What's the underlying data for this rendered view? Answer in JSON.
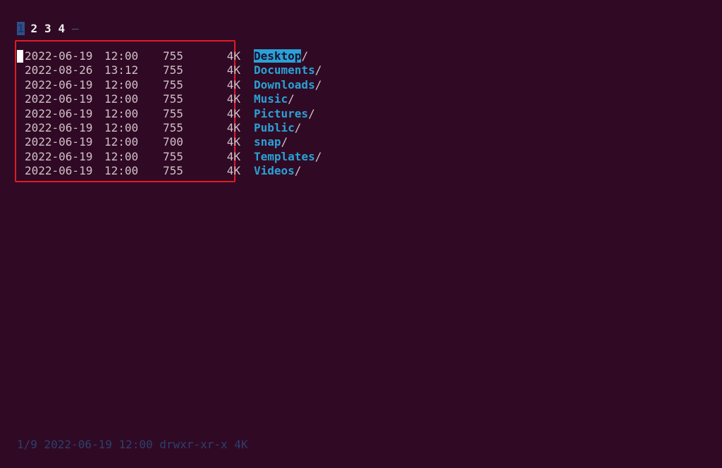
{
  "tabs": {
    "items": [
      "1",
      "2",
      "3",
      "4"
    ],
    "active_index": 0,
    "trailing": "–"
  },
  "listing": {
    "rows": [
      {
        "date": "2022-06-19",
        "time": "12:00",
        "perm": "755",
        "size": "4K",
        "name": "Desktop",
        "suffix": "/",
        "selected": true
      },
      {
        "date": "2022-08-26",
        "time": "13:12",
        "perm": "755",
        "size": "4K",
        "name": "Documents",
        "suffix": "/",
        "selected": false
      },
      {
        "date": "2022-06-19",
        "time": "12:00",
        "perm": "755",
        "size": "4K",
        "name": "Downloads",
        "suffix": "/",
        "selected": false
      },
      {
        "date": "2022-06-19",
        "time": "12:00",
        "perm": "755",
        "size": "4K",
        "name": "Music",
        "suffix": "/",
        "selected": false
      },
      {
        "date": "2022-06-19",
        "time": "12:00",
        "perm": "755",
        "size": "4K",
        "name": "Pictures",
        "suffix": "/",
        "selected": false
      },
      {
        "date": "2022-06-19",
        "time": "12:00",
        "perm": "755",
        "size": "4K",
        "name": "Public",
        "suffix": "/",
        "selected": false
      },
      {
        "date": "2022-06-19",
        "time": "12:00",
        "perm": "700",
        "size": "4K",
        "name": "snap",
        "suffix": "/",
        "selected": false
      },
      {
        "date": "2022-06-19",
        "time": "12:00",
        "perm": "755",
        "size": "4K",
        "name": "Templates",
        "suffix": "/",
        "selected": false
      },
      {
        "date": "2022-06-19",
        "time": "12:00",
        "perm": "755",
        "size": "4K",
        "name": "Videos",
        "suffix": "/",
        "selected": false
      }
    ]
  },
  "status": {
    "text": "1/9 2022-06-19 12:00 drwxr-xr-x 4K"
  },
  "colors": {
    "background": "#300a24",
    "highlight_border": "#e01b24",
    "directory": "#2aa1d6"
  }
}
